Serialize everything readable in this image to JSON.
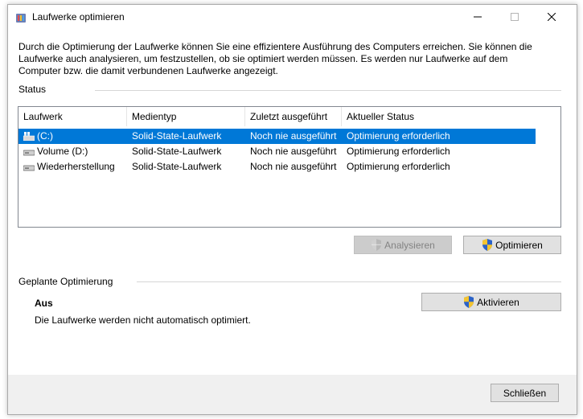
{
  "window": {
    "title": "Laufwerke optimieren",
    "app_icon": "defrag-app-icon",
    "controls": {
      "minimize": "minimize-icon",
      "maximize": "maximize-icon",
      "close": "close-icon"
    }
  },
  "description": "Durch die Optimierung der Laufwerke können Sie eine effizientere Ausführung des Computers erreichen. Sie können die Laufwerke auch analysieren, um festzustellen, ob sie optimiert werden müssen. Es werden nur Laufwerke auf dem Computer bzw. die damit verbundenen Laufwerke angezeigt.",
  "status": {
    "label": "Status",
    "columns": [
      "Laufwerk",
      "Medientyp",
      "Zuletzt ausgeführt",
      "Aktueller Status"
    ],
    "rows": [
      {
        "drive": "(C:)",
        "icon": "system-drive-icon",
        "media": "Solid-State-Laufwerk",
        "last_run": "Noch nie ausgeführt",
        "state": "Optimierung erforderlich",
        "selected": true
      },
      {
        "drive": "Volume (D:)",
        "icon": "drive-icon",
        "media": "Solid-State-Laufwerk",
        "last_run": "Noch nie ausgeführt",
        "state": "Optimierung erforderlich",
        "selected": false
      },
      {
        "drive": "Wiederherstellung",
        "icon": "drive-icon",
        "media": "Solid-State-Laufwerk",
        "last_run": "Noch nie ausgeführt",
        "state": "Optimierung erforderlich",
        "selected": false
      }
    ],
    "analyze_button": "Analysieren",
    "optimize_button": "Optimieren"
  },
  "scheduled": {
    "label": "Geplante Optimierung",
    "state_title": "Aus",
    "state_text": "Die Laufwerke werden nicht automatisch optimiert.",
    "activate_button": "Aktivieren"
  },
  "close_button": "Schließen",
  "colors": {
    "selection": "#0078d7",
    "footer": "#f0f0f0",
    "button_face": "#e1e1e1"
  }
}
